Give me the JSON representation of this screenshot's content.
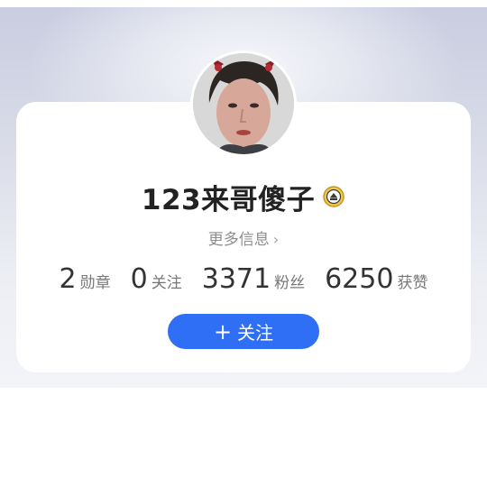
{
  "profile": {
    "name": "123来哥傻子",
    "more_info_label": "更多信息",
    "avatar_icon": "user-avatar",
    "badge_icon": "level-badge-icon",
    "chevron_icon": "chevron-right-icon"
  },
  "stats": [
    {
      "value": "2",
      "label": "勋章"
    },
    {
      "value": "0",
      "label": "关注"
    },
    {
      "value": "3371",
      "label": "粉丝"
    },
    {
      "value": "6250",
      "label": "获赞"
    }
  ],
  "follow_button": {
    "plus": "+",
    "label": "关注"
  },
  "colors": {
    "accent": "#2f6ff6",
    "card_bg": "#ffffff",
    "header_bg": "#d6d9e6"
  }
}
